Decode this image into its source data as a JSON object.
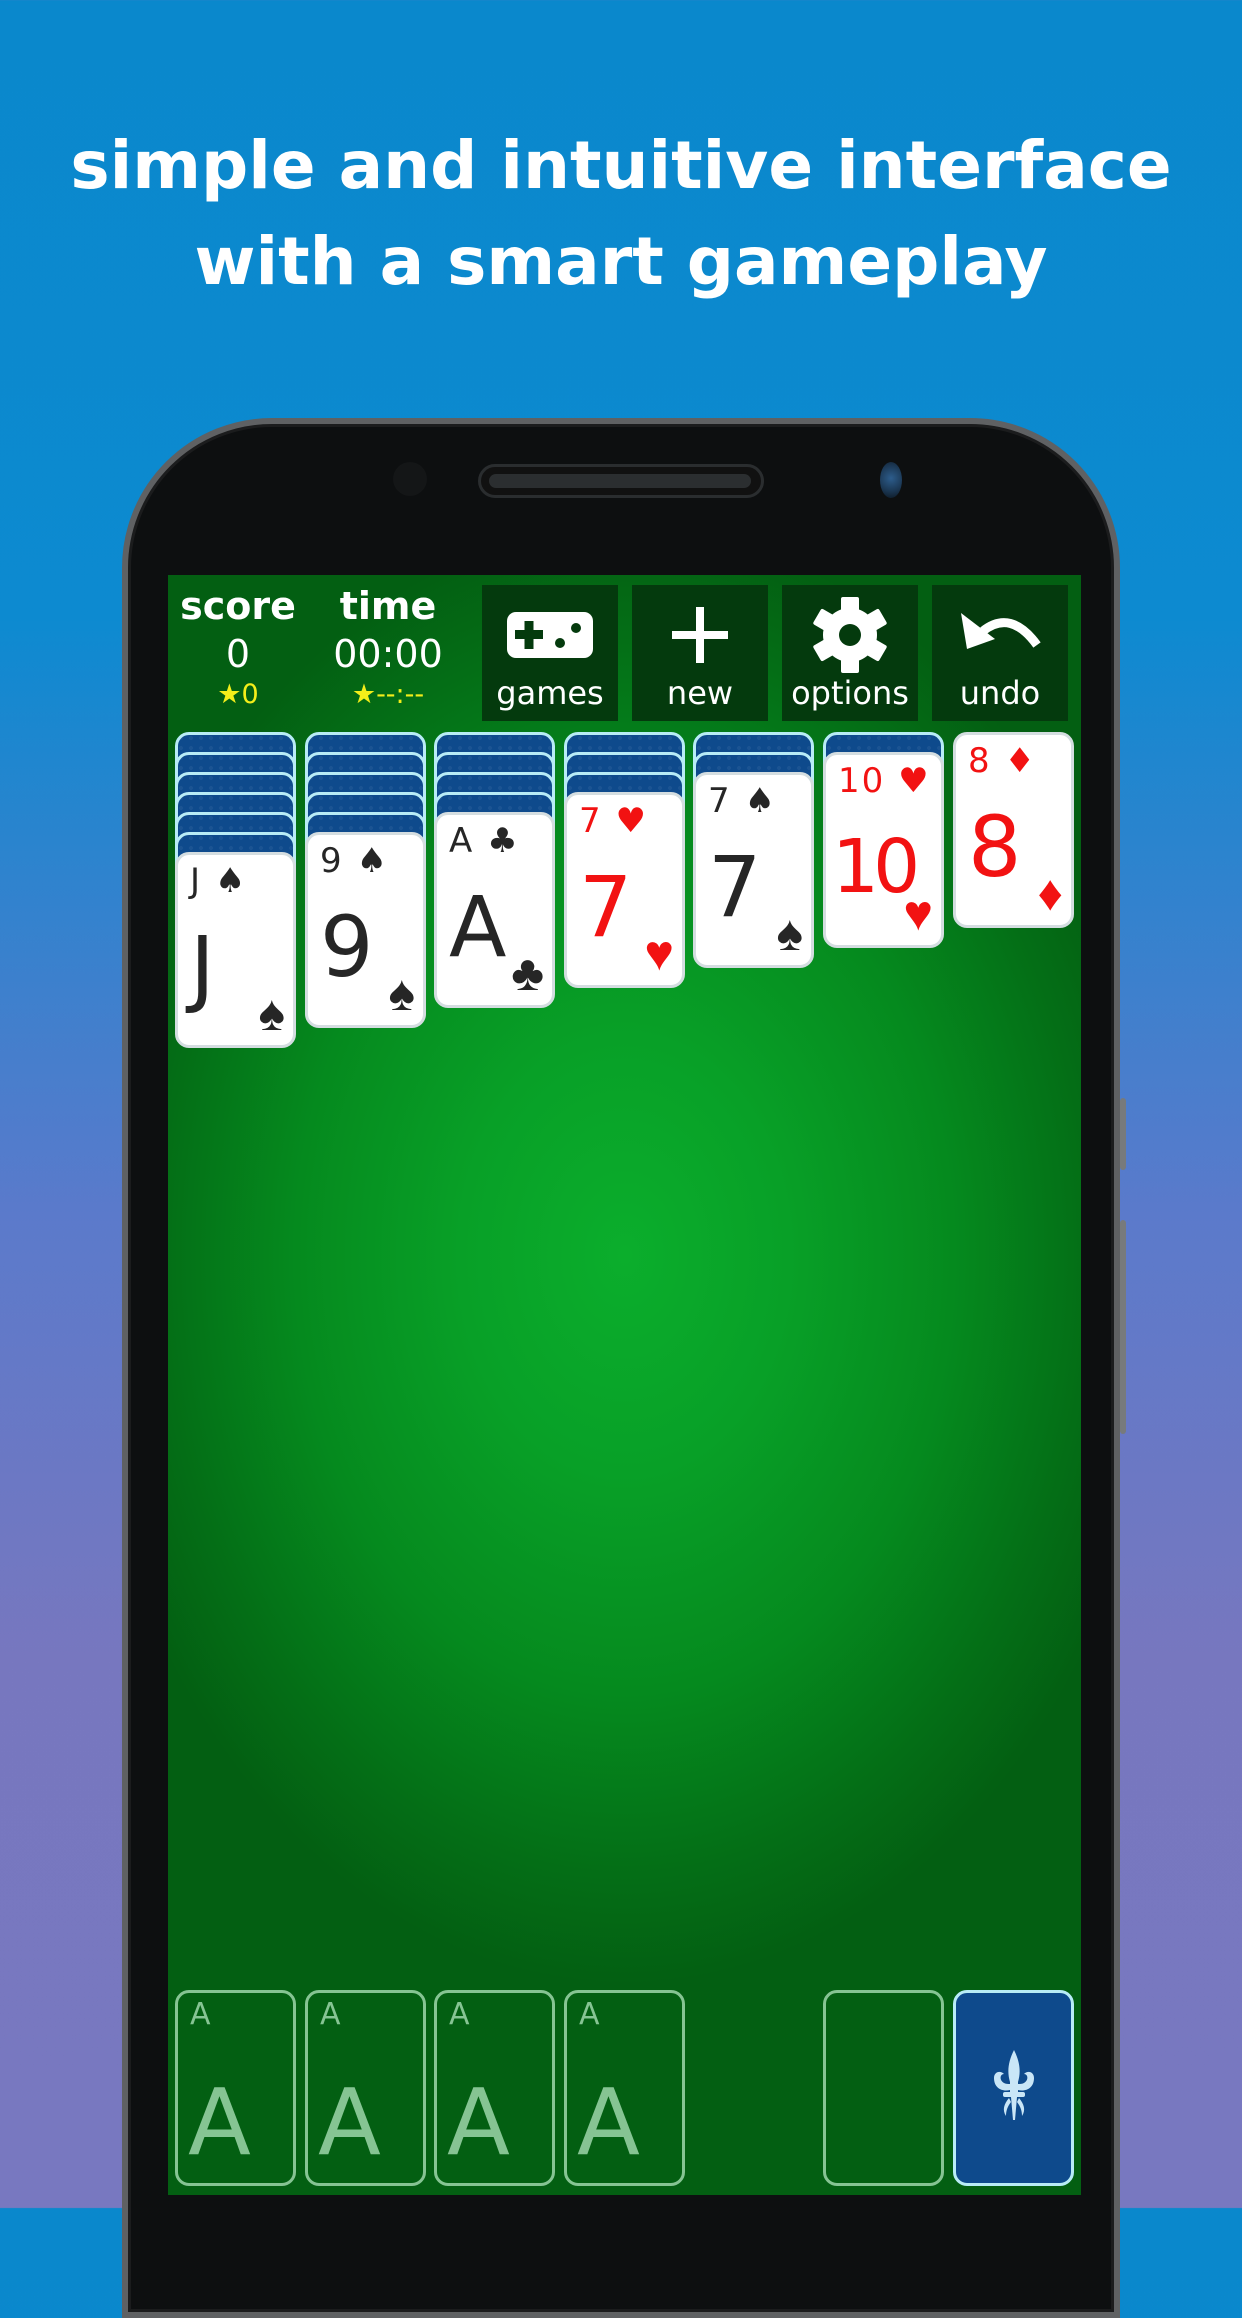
{
  "headline": {
    "line1": "simple and intuitive interface",
    "line2": "with a smart gameplay"
  },
  "hud": {
    "score": {
      "label": "score",
      "value": "0",
      "best": "★0"
    },
    "time": {
      "label": "time",
      "value": "00:00",
      "best": "★--:--"
    },
    "buttons": [
      {
        "id": "games",
        "label": "games",
        "icon": "gamepad-icon"
      },
      {
        "id": "new",
        "label": "new",
        "icon": "plus-icon"
      },
      {
        "id": "options",
        "label": "options",
        "icon": "gear-icon"
      },
      {
        "id": "undo",
        "label": "undo",
        "icon": "undo-icon"
      }
    ]
  },
  "tableau": [
    {
      "hidden": 6,
      "card": {
        "rank": "J",
        "suit": "♠",
        "color": "black"
      }
    },
    {
      "hidden": 5,
      "card": {
        "rank": "9",
        "suit": "♠",
        "color": "black"
      }
    },
    {
      "hidden": 4,
      "card": {
        "rank": "A",
        "suit": "♣",
        "color": "black"
      }
    },
    {
      "hidden": 3,
      "card": {
        "rank": "7",
        "suit": "♥",
        "color": "red"
      }
    },
    {
      "hidden": 2,
      "card": {
        "rank": "7",
        "suit": "♠",
        "color": "black"
      }
    },
    {
      "hidden": 1,
      "card": {
        "rank": "10",
        "suit": "♥",
        "color": "red"
      }
    },
    {
      "hidden": 0,
      "card": {
        "rank": "8",
        "suit": "♦",
        "color": "red"
      }
    }
  ],
  "foundations": [
    {
      "placeholder": "A"
    },
    {
      "placeholder": "A"
    },
    {
      "placeholder": "A"
    },
    {
      "placeholder": "A"
    }
  ],
  "waste": {
    "empty": true
  },
  "stock": {
    "icon": "fleur-de-lis-icon"
  },
  "colors": {
    "felt": "#0aa82a",
    "card_back": "#0e4a8c",
    "card_back_border": "#b8ecf6",
    "red_suit": "#f21212",
    "best_yellow": "#f3ee1a",
    "button_bg": "#043a0d"
  }
}
